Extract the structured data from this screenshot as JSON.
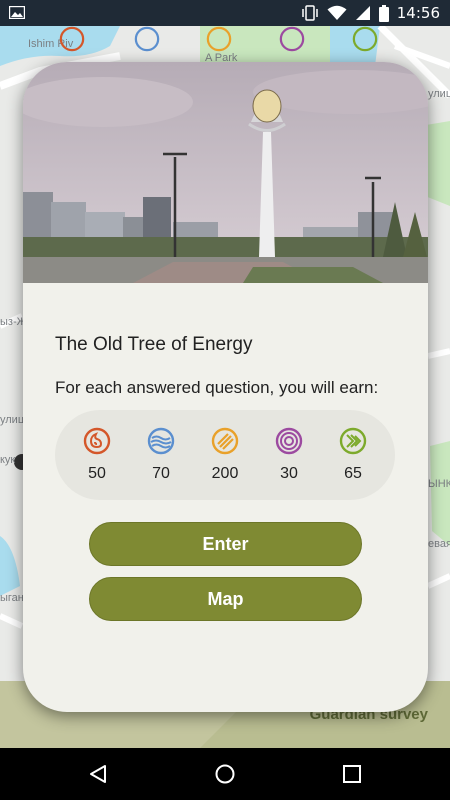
{
  "status_bar": {
    "time": "14:56",
    "icons": [
      "gallery-icon",
      "vibrate-icon",
      "wifi-icon",
      "signal-icon",
      "battery-icon"
    ]
  },
  "map": {
    "labels": {
      "ishim": "Ishim Riv",
      "park": "A   Park",
      "ulits": "улиц",
      "yz": "ыз-Ж",
      "ulitsa": "улица",
      "kuk": "кук",
      "ynk": "ЫНК",
      "evaya": "евая",
      "ygan": "ыган"
    },
    "guardian_label": "Guardian survey",
    "colors": {
      "water": "#a9dcee",
      "park": "#c9e7be",
      "road": "#ffffff",
      "field": "#c3c59e"
    }
  },
  "card": {
    "photo_alt": "Baiterek tower",
    "title": "The Old Tree of Energy",
    "subtitle": "For each answered question, you will earn:",
    "rewards": [
      {
        "icon": "fire-spiral-icon",
        "color": "#d4572a",
        "value": "50"
      },
      {
        "icon": "water-waves-icon",
        "color": "#5b8fcf",
        "value": "70"
      },
      {
        "icon": "sun-stripes-icon",
        "color": "#e9a12a",
        "value": "200"
      },
      {
        "icon": "spiral-icon",
        "color": "#9c4aa0",
        "value": "30"
      },
      {
        "icon": "leaf-chevron-icon",
        "color": "#7daa2c",
        "value": "65"
      }
    ],
    "buttons": {
      "enter": "Enter",
      "map": "Map"
    },
    "accent": "#7f8a33"
  },
  "nav_bar": {
    "icons": [
      "back-icon",
      "home-icon",
      "recents-icon"
    ]
  }
}
